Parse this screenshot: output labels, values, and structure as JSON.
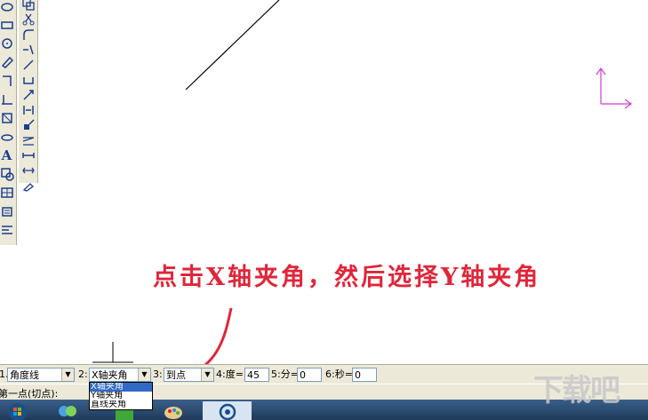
{
  "left_toolbar": {
    "tools": [
      "ellipse-tool",
      "rectangle-tool",
      "circle-tool",
      "eraser-tool",
      "polyline-tool",
      "angle-tool",
      "dimension-tool",
      "point-tool",
      "text-tool",
      "hatch-tool",
      "table-tool",
      "insert-tool",
      "align-tool"
    ],
    "text_tool_label": "A"
  },
  "right_toolbar": {
    "tools": [
      "copy-tool",
      "scissors-tool",
      "fillet-tool",
      "extend-tool",
      "line-tool",
      "frame-tool",
      "explode-tool",
      "bracket-tool",
      "move-tool",
      "array-tool",
      "measure-tool",
      "stretch-tool",
      "brush-tool"
    ]
  },
  "annotation": {
    "text": "点击X轴夹角，然后选择Y轴夹角",
    "color": "#e0263a"
  },
  "command_bar": {
    "prefix_1": "1.",
    "param1_value": "角度线",
    "prefix_2": "2:",
    "param2_value": "X轴夹角",
    "prefix_3": "3:",
    "param3_value": "到点",
    "degree_label": "4:度=",
    "degree_value": "45",
    "minute_label": "5:分=",
    "minute_value": "0",
    "second_label": "6:秒=",
    "second_value": "0"
  },
  "dropdown_options": [
    "X轴夹角",
    "Y轴夹角",
    "直线夹角"
  ],
  "dropdown_selected": "X轴夹角",
  "status": {
    "prompt": "第一点(切点):"
  },
  "watermark": "下载吧",
  "colors": {
    "annotation": "#e0263a",
    "coordinate_axis": "#d43ad4",
    "selection": "#316ac5"
  }
}
